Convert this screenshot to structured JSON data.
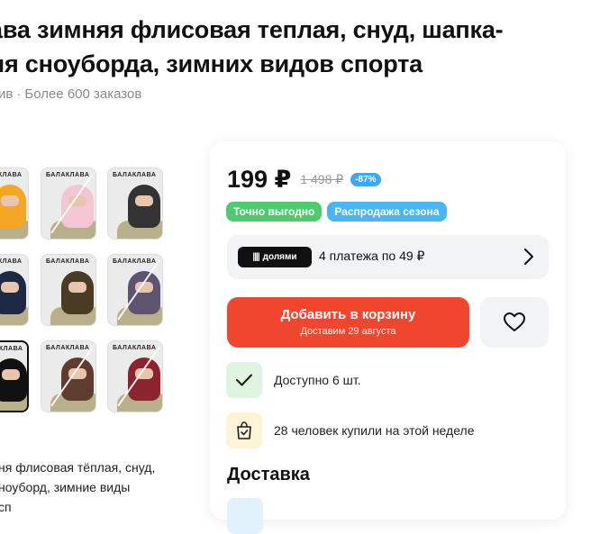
{
  "product": {
    "title": "ава зимняя флисовая теплая, снуд, шапка-\nля сноуборда, зимних видов спорта",
    "meta_left": "ив",
    "meta_sep": "·",
    "orders": "Более 600 заказов",
    "description": "ня флисовая тёплая, снуд,\nноуборд, зимние виды\nсп"
  },
  "gallery": {
    "caption": "БАЛАКЛАВА",
    "thumbnails": [
      {
        "color": "#f5a623"
      },
      {
        "color": "#f2c6d2"
      },
      {
        "color": "#333333"
      },
      {
        "color": "#1d2a45"
      },
      {
        "color": "#4a3b25"
      },
      {
        "color": "#5e5370"
      },
      {
        "color": "#111111"
      },
      {
        "color": "#5e3d2f"
      },
      {
        "color": "#8c2430"
      }
    ]
  },
  "buy_box": {
    "price": "199 ₽",
    "old_price": "1 498 ₽",
    "discount": "-87%",
    "tags": [
      "Точно выгодно",
      "Распродажа сезона"
    ],
    "installments": {
      "badge": "долями",
      "text": "4 платежа по 49 ₽"
    },
    "add_to_cart": "Добавить в корзину",
    "delivery_date": "Доставим 29 августа",
    "availability": "Доступно 6 шт.",
    "bought_this_week": "28 человек купили на этой неделе",
    "delivery_heading": "Доставка"
  },
  "colors": {
    "accent": "#f1462e",
    "tag_green": "#4ecb6e",
    "tag_blue": "#49b6f2",
    "discount": "#3ea8f5"
  }
}
